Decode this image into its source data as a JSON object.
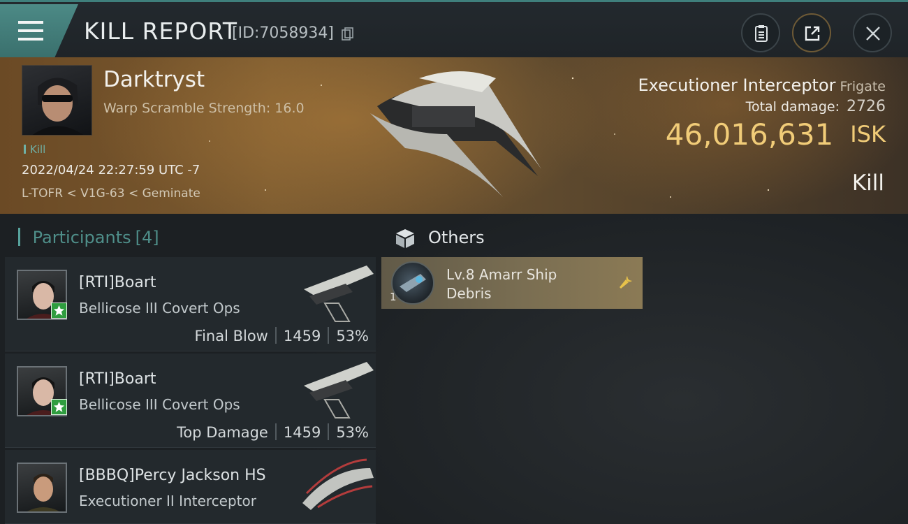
{
  "header": {
    "title": "KILL REPORT",
    "report_id": "[ID:7058934]"
  },
  "victim": {
    "name": "Darktryst",
    "stat": "Warp Scramble Strength: 16.0",
    "tag": "Kill",
    "datetime": "2022/04/24 22:27:59 UTC -7",
    "location": "L-TOFR < V1G-63 < Geminate",
    "ship_name": "Executioner Interceptor",
    "ship_class": "Frigate",
    "damage_label": "Total damage:",
    "damage_value": "2726",
    "isk_value": "46,016,631",
    "isk_unit": "ISK",
    "result": "Kill"
  },
  "participants": {
    "title": "Participants",
    "count": "[4]",
    "rows": [
      {
        "name": "[RTI]Boart",
        "ship": "Bellicose III Covert Ops",
        "role": "Final Blow",
        "damage": "1459",
        "percent": "53%"
      },
      {
        "name": "[RTI]Boart",
        "ship": "Bellicose III Covert Ops",
        "role": "Top Damage",
        "damage": "1459",
        "percent": "53%"
      },
      {
        "name": "[BBBQ]Percy Jackson HS",
        "ship": "Executioner II Interceptor"
      }
    ]
  },
  "others": {
    "title": "Others",
    "items": [
      {
        "quantity": "1",
        "name": "Lv.8 Amarr Ship Debris"
      }
    ]
  },
  "colors": {
    "accent_teal": "#4c8a86",
    "isk_gold": "#f1cc78",
    "badge_green": "#2f9d3f"
  },
  "icons": [
    "menu-icon",
    "copy-icon",
    "clipboard-icon",
    "share-icon",
    "close-icon",
    "star-icon",
    "cube-icon",
    "wrench-icon"
  ]
}
